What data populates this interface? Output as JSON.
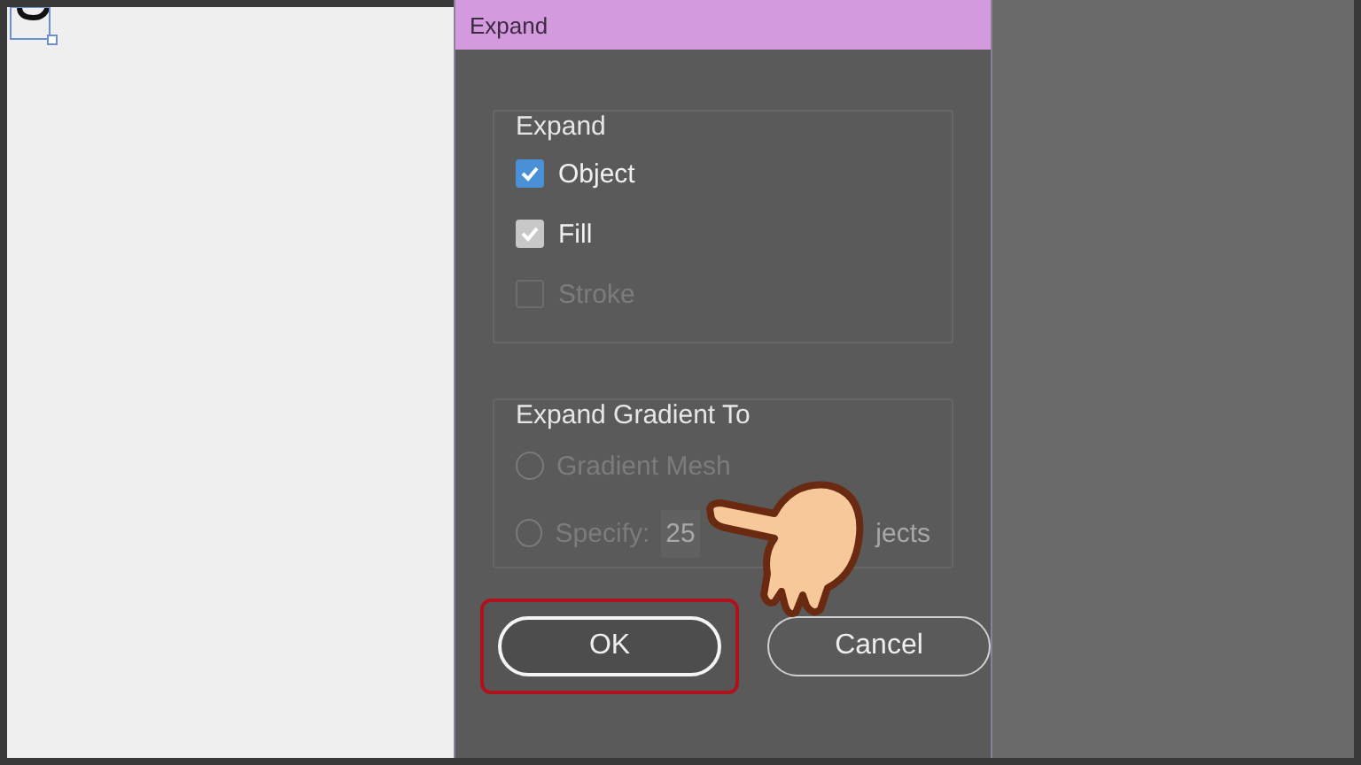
{
  "dialog": {
    "title": "Expand",
    "expand_group": {
      "legend": "Expand",
      "options": [
        {
          "label": "Object",
          "checked": true,
          "disabled": false,
          "focused": true
        },
        {
          "label": "Fill",
          "checked": true,
          "disabled": false,
          "focused": false
        },
        {
          "label": "Stroke",
          "checked": false,
          "disabled": true,
          "focused": false
        }
      ]
    },
    "gradient_group": {
      "legend": "Expand Gradient To",
      "options": [
        {
          "kind": "radio",
          "label": "Gradient Mesh",
          "selected": false,
          "disabled": true
        },
        {
          "kind": "specify",
          "label": "Specify:",
          "value": "25",
          "suffix": "jects",
          "selected": false,
          "disabled": true
        }
      ]
    },
    "buttons": [
      {
        "label": "OK",
        "default": true,
        "highlighted": true
      },
      {
        "label": "Cancel",
        "default": false,
        "highlighted": false
      }
    ]
  }
}
